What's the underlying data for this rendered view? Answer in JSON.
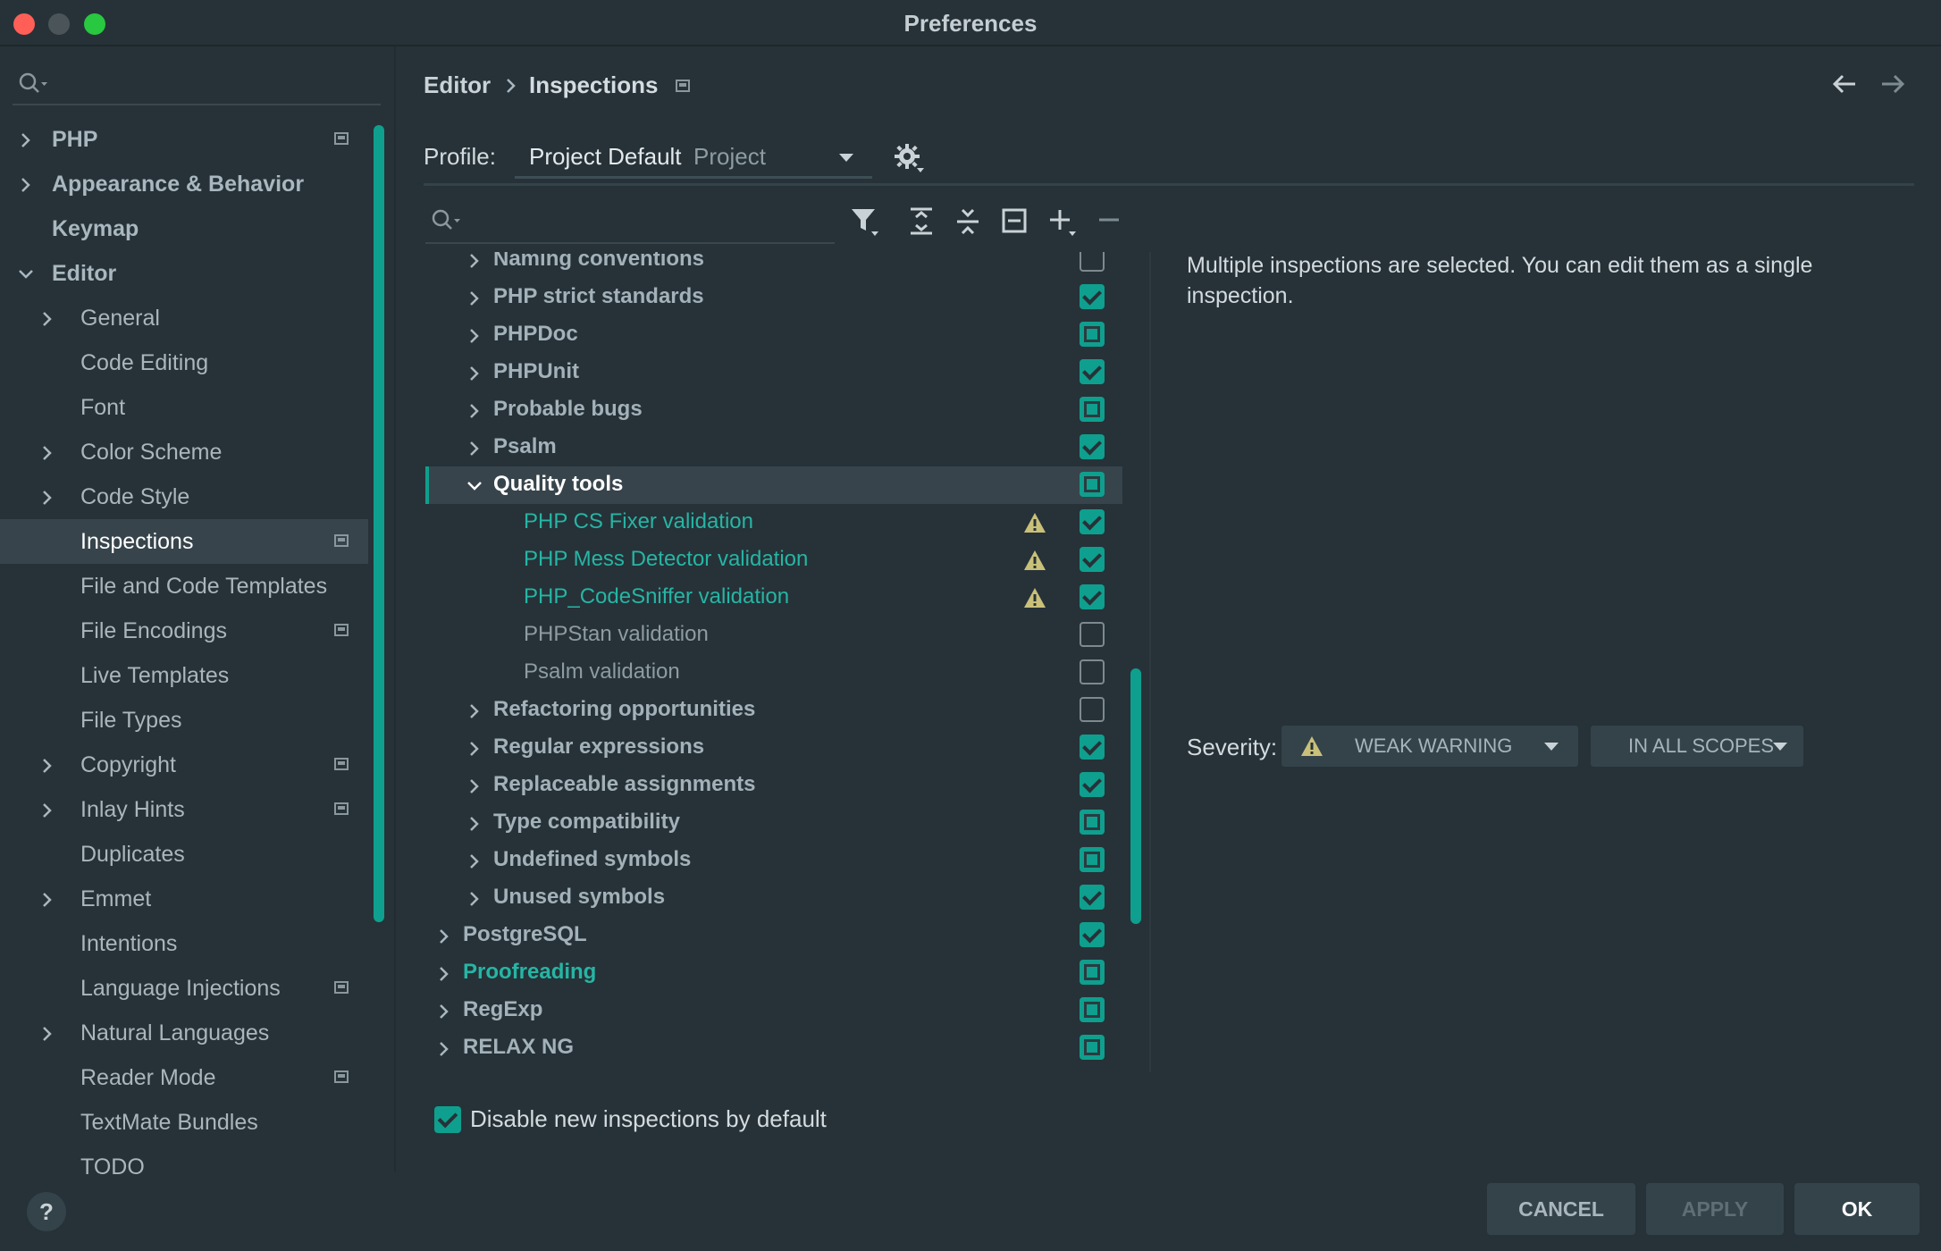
{
  "window": {
    "title": "Preferences"
  },
  "sidebar": {
    "search": {
      "placeholder": ""
    },
    "items": [
      {
        "label": "PHP",
        "chevron": "right",
        "bold": true,
        "badge": true
      },
      {
        "label": "Appearance & Behavior",
        "chevron": "right",
        "bold": true,
        "badge": false
      },
      {
        "label": "Keymap",
        "chevron": "",
        "bold": true,
        "badge": false
      },
      {
        "label": "Editor",
        "chevron": "down",
        "bold": true,
        "badge": false
      },
      {
        "label": "General",
        "chevron": "right",
        "bold": false,
        "badge": false
      },
      {
        "label": "Code Editing",
        "chevron": "",
        "bold": false,
        "badge": false
      },
      {
        "label": "Font",
        "chevron": "",
        "bold": false,
        "badge": false
      },
      {
        "label": "Color Scheme",
        "chevron": "right",
        "bold": false,
        "badge": false
      },
      {
        "label": "Code Style",
        "chevron": "right",
        "bold": false,
        "badge": false
      },
      {
        "label": "Inspections",
        "chevron": "",
        "bold": false,
        "badge": true,
        "selected": true
      },
      {
        "label": "File and Code Templates",
        "chevron": "",
        "bold": false,
        "badge": false
      },
      {
        "label": "File Encodings",
        "chevron": "",
        "bold": false,
        "badge": true
      },
      {
        "label": "Live Templates",
        "chevron": "",
        "bold": false,
        "badge": false
      },
      {
        "label": "File Types",
        "chevron": "",
        "bold": false,
        "badge": false
      },
      {
        "label": "Copyright",
        "chevron": "right",
        "bold": false,
        "badge": true
      },
      {
        "label": "Inlay Hints",
        "chevron": "right",
        "bold": false,
        "badge": true
      },
      {
        "label": "Duplicates",
        "chevron": "",
        "bold": false,
        "badge": false
      },
      {
        "label": "Emmet",
        "chevron": "right",
        "bold": false,
        "badge": false
      },
      {
        "label": "Intentions",
        "chevron": "",
        "bold": false,
        "badge": false
      },
      {
        "label": "Language Injections",
        "chevron": "",
        "bold": false,
        "badge": true
      },
      {
        "label": "Natural Languages",
        "chevron": "right",
        "bold": false,
        "badge": false
      },
      {
        "label": "Reader Mode",
        "chevron": "",
        "bold": false,
        "badge": true
      },
      {
        "label": "TextMate Bundles",
        "chevron": "",
        "bold": false,
        "badge": false
      },
      {
        "label": "TODO",
        "chevron": "",
        "bold": false,
        "badge": false
      }
    ]
  },
  "header": {
    "breadcrumb": [
      "Editor",
      "Inspections"
    ],
    "nav_back_icon": "arrow-left-icon",
    "nav_forward_icon": "arrow-right-icon"
  },
  "profile": {
    "label": "Profile:",
    "name": "Project Default",
    "scope": "Project"
  },
  "tree": {
    "search": {
      "placeholder": ""
    },
    "rows": [
      {
        "label": "Naming conventions",
        "level": 1,
        "chevron": "right",
        "state": "empty",
        "style": "bold"
      },
      {
        "label": "PHP strict standards",
        "level": 1,
        "chevron": "right",
        "state": "checked",
        "style": "bold"
      },
      {
        "label": "PHPDoc",
        "level": 1,
        "chevron": "right",
        "state": "partial",
        "style": "bold"
      },
      {
        "label": "PHPUnit",
        "level": 1,
        "chevron": "right",
        "state": "checked",
        "style": "bold"
      },
      {
        "label": "Probable bugs",
        "level": 1,
        "chevron": "right",
        "state": "partial",
        "style": "bold"
      },
      {
        "label": "Psalm",
        "level": 1,
        "chevron": "right",
        "state": "checked",
        "style": "bold"
      },
      {
        "label": "Quality tools",
        "level": 1,
        "chevron": "down",
        "state": "partial",
        "style": "white",
        "selected": true
      },
      {
        "label": "PHP CS Fixer validation",
        "level": 2,
        "chevron": "",
        "state": "checked",
        "style": "teal",
        "warning": true
      },
      {
        "label": "PHP Mess Detector validation",
        "level": 2,
        "chevron": "",
        "state": "checked",
        "style": "teal",
        "warning": true
      },
      {
        "label": "PHP_CodeSniffer validation",
        "level": 2,
        "chevron": "",
        "state": "checked",
        "style": "teal",
        "warning": true
      },
      {
        "label": "PHPStan validation",
        "level": 2,
        "chevron": "",
        "state": "empty",
        "style": "dim"
      },
      {
        "label": "Psalm validation",
        "level": 2,
        "chevron": "",
        "state": "empty",
        "style": "dim"
      },
      {
        "label": "Refactoring opportunities",
        "level": 1,
        "chevron": "right",
        "state": "empty",
        "style": "bold"
      },
      {
        "label": "Regular expressions",
        "level": 1,
        "chevron": "right",
        "state": "checked",
        "style": "bold"
      },
      {
        "label": "Replaceable assignments",
        "level": 1,
        "chevron": "right",
        "state": "checked",
        "style": "bold"
      },
      {
        "label": "Type compatibility",
        "level": 1,
        "chevron": "right",
        "state": "partial",
        "style": "bold"
      },
      {
        "label": "Undefined symbols",
        "level": 1,
        "chevron": "right",
        "state": "partial",
        "style": "bold"
      },
      {
        "label": "Unused symbols",
        "level": 1,
        "chevron": "right",
        "state": "checked",
        "style": "bold"
      },
      {
        "label": "PostgreSQL",
        "level": 0,
        "chevron": "right",
        "state": "checked",
        "style": "bold"
      },
      {
        "label": "Proofreading",
        "level": 0,
        "chevron": "right",
        "state": "partial",
        "style": "teal-bold"
      },
      {
        "label": "RegExp",
        "level": 0,
        "chevron": "right",
        "state": "partial",
        "style": "bold"
      },
      {
        "label": "RELAX NG",
        "level": 0,
        "chevron": "right",
        "state": "partial",
        "style": "bold"
      }
    ]
  },
  "details": {
    "description": "Multiple inspections are selected. You can edit them as a single inspection.",
    "severity_label": "Severity:",
    "severity_value": "WEAK WARNING",
    "scope_value": "IN ALL SCOPES"
  },
  "footer": {
    "disable_new_label": "Disable new inspections by default",
    "help": "?",
    "cancel": "CANCEL",
    "apply": "APPLY",
    "ok": "OK"
  },
  "colors": {
    "accent": "#0F9F8E",
    "background": "#263238",
    "selection": "#37444B",
    "warning": "#C9C07A"
  }
}
